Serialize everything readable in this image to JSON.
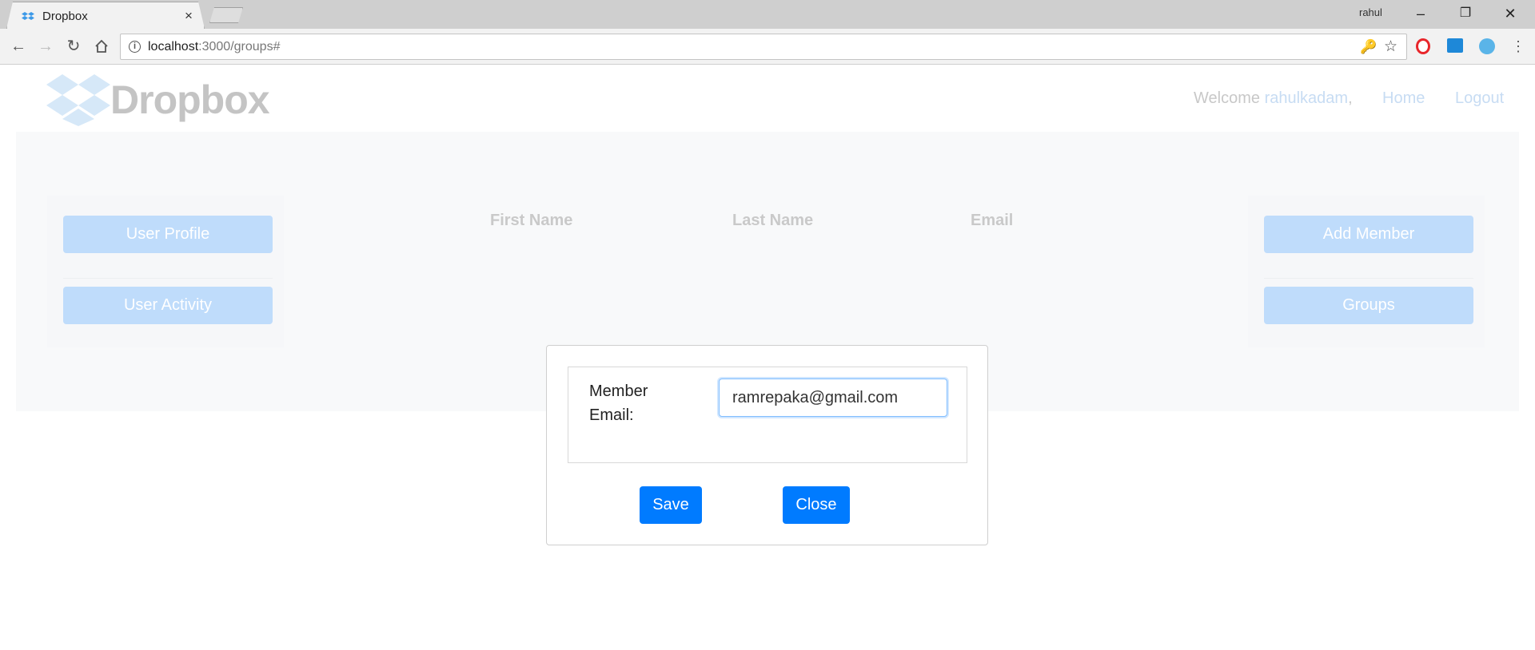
{
  "browser": {
    "tab_title": "Dropbox",
    "tab_close": "×",
    "profile_name": "rahul",
    "url_host": "localhost",
    "url_path": ":3000/groups#",
    "minimize": "–",
    "restore": "❐",
    "close": "✕"
  },
  "header": {
    "logo_text": "Dropbox",
    "welcome_label": "Welcome",
    "username": "rahulkadam",
    "comma": ",",
    "home_link": "Home",
    "logout_link": "Logout"
  },
  "left_menu": {
    "user_profile": "User Profile",
    "user_activity": "User Activity"
  },
  "right_menu": {
    "add_member": "Add Member",
    "groups": "Groups"
  },
  "table": {
    "headers": [
      "First Name",
      "Last Name",
      "Email"
    ]
  },
  "modal": {
    "label": "Member Email:",
    "email_value": "ramrepaka@gmail.com",
    "save": "Save",
    "close": "Close"
  },
  "colors": {
    "primary": "#007bff",
    "faded_button": "#bfdcfb",
    "faded_link": "#c7dcf3"
  }
}
